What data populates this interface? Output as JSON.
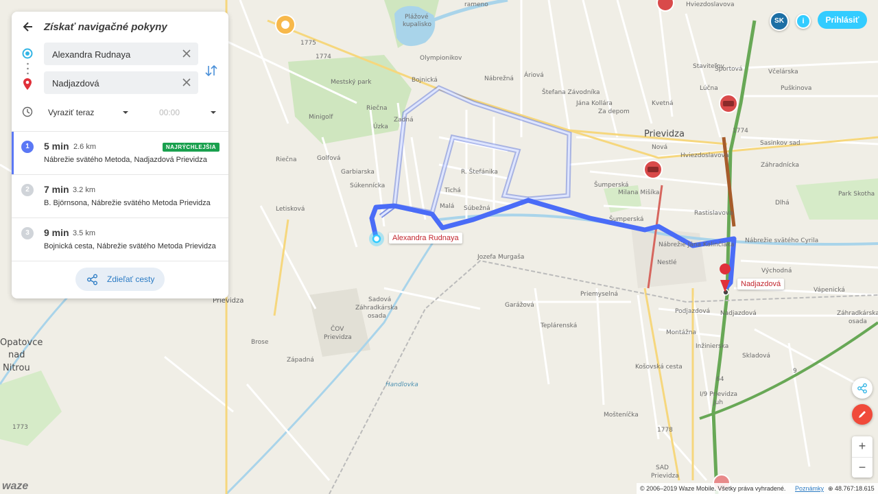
{
  "panel": {
    "title": "Získať navigačné pokyny",
    "origin_value": "Alexandra Rudnaya",
    "destination_value": "Nadjazdová",
    "depart_option": "Vyraziť teraz",
    "depart_time": "00:00",
    "routes": [
      {
        "index": "1",
        "time": "5 min",
        "distance": "2.6 km",
        "description": "Nábrežie svätého Metoda, Nadjazdová Prievidza",
        "badge": "NAJRÝCHLEJŠIA",
        "selected": true
      },
      {
        "index": "2",
        "time": "7 min",
        "distance": "3.2 km",
        "description": "B. Björnsona, Nábrežie svätého Metoda Prievidza"
      },
      {
        "index": "3",
        "time": "9 min",
        "distance": "3.5 km",
        "description": "Bojnická cesta, Nábrežie svätého Metoda Prievidza"
      }
    ],
    "share_label": "Zdieľať cesty"
  },
  "topbar": {
    "lang": "SK",
    "info": "i",
    "login_label": "Prihlásiť"
  },
  "pins": {
    "origin_label": "Alexandra Rudnaya",
    "destination_label": "Nadjazdová"
  },
  "zoom": {
    "in": "+",
    "out": "−"
  },
  "logo": "waze",
  "footer": {
    "copyright": "© 2006–2019 Waze Mobile. Všetky práva vyhradené.",
    "notes_link": "Poznámky",
    "coords": "⊕ 48.767:18.615"
  },
  "map_labels": {
    "prievidza": "Prievidza",
    "prievidza_sub": "Prievidza",
    "opatovce": "Opatovce",
    "nad": "nad",
    "nitrou": "Nitrou",
    "plazove": "Plážové",
    "kupalisko": "kupalisko",
    "mestsky_park": "Mestský park",
    "mingolf": "Minigolf",
    "park_skotha": "Park Skotha",
    "nestle": "Nestlé",
    "brose": "Brose",
    "cov": "ČOV",
    "cov_prievidza": "Prievidza",
    "zahradkarska": "Záhradkárska",
    "osada": "osada",
    "zahradkarska2": "Záhradkárska",
    "osada2": "osada",
    "handlovka": "Handlovka",
    "sad": "SAD",
    "sad_prievidza": "Prievidza",
    "i9": "I/9 Prievidza",
    "juh": "Juh",
    "rameno": "rameno",
    "hviezdoslavova": "Hviezdoslavova",
    "hviezdoslavova2": "Hviezdoslavova",
    "puskinova": "Puškinova",
    "velarska": "Včelárska",
    "sasinkov": "Sasinkov sad",
    "dlha": "Dlhá",
    "nabrezie_cyrila": "Nábrežie svätého Cyrila",
    "nabrezie_jana": "Nábrežie Jána Kalinčiaka",
    "sumperska": "Šumperská",
    "sumperska2": "Šumperská",
    "milana": "Milana Mišíka",
    "priemyselna": "Priemyselná",
    "garazova": "Garážová",
    "podjazdova": "Podjazdová",
    "montazna": "Montážna",
    "jozefa": "Jozefa Murgaša",
    "sadova": "Sadová",
    "subezna": "Súbežná",
    "mala": "Malá",
    "ticha": "Tichá",
    "stefanika": "R. Štefánika",
    "riecna": "Riečna",
    "riecna2": "Riečna",
    "vapenicka": "Vápenická",
    "vychodna": "Východná",
    "rastislavova": "Rastislavova",
    "nabrezna": "Nábrežná",
    "ariova": "Áriová",
    "zavodnika": "Štefana Závodníka",
    "kollara": "Jána Kollára",
    "za_depom": "Za depom",
    "kvetna": "Kvetná",
    "nova": "Nová",
    "lucna": "Lúčna",
    "sportova": "Športová",
    "staviteľov": "Staviteľov",
    "letisko": "Letisková",
    "sukennicka": "Súkennícka",
    "garbiarska": "Garbiarska",
    "golfova": "Golfová",
    "zahradnicka": "Záhradnícka",
    "n1775": "1775",
    "n1774": "1774",
    "n1774b": "1774",
    "n1778": "1778",
    "n1773": "1773",
    "n9": "9",
    "n64": "64",
    "bojnicka": "Bojnická",
    "olympionikov": "Olympionikov",
    "zadna": "Zadná",
    "uzka": "Úzka",
    "nadjazdova_street": "Nadjazdová",
    "inzinierska": "Inžinierska",
    "skladova": "Skladová",
    "mostenicka": "Mošteníčka",
    "kosovska": "Košovská cesta",
    "zapadna": "Západná",
    "teplarenska": "Teplárenská"
  }
}
